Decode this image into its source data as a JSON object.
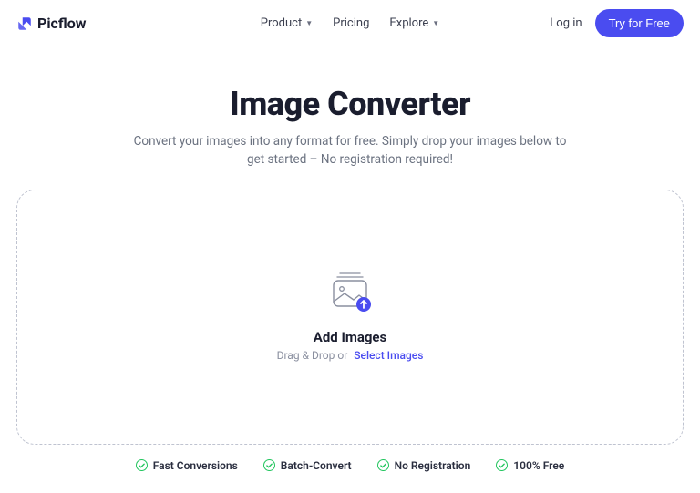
{
  "brand": {
    "name": "Picflow"
  },
  "nav": {
    "items": [
      {
        "label": "Product",
        "has_dropdown": true
      },
      {
        "label": "Pricing",
        "has_dropdown": false
      },
      {
        "label": "Explore",
        "has_dropdown": true
      }
    ],
    "login": "Log in",
    "cta": "Try for Free"
  },
  "hero": {
    "title": "Image Converter",
    "subtitle": "Convert your images into any format for free. Simply drop your images below to get started – No registration required!"
  },
  "dropzone": {
    "title": "Add Images",
    "drag_text": "Drag & Drop or",
    "select_link": "Select Images"
  },
  "features": [
    "Fast Conversions",
    "Batch-Convert",
    "No Registration",
    "100% Free"
  ],
  "colors": {
    "accent": "#4a4cf0",
    "success": "#22c55e"
  }
}
